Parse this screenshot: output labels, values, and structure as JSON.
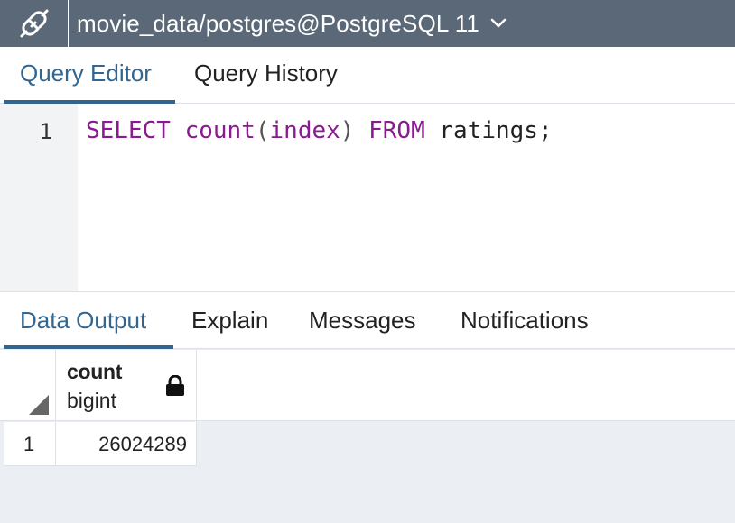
{
  "titlebar": {
    "connection_label": "movie_data/postgres@PostgreSQL 11",
    "connection_icon": "plug-disconnected-icon",
    "dropdown_icon": "chevron-down-icon"
  },
  "editor_tabs": [
    {
      "label": "Query Editor",
      "active": true
    },
    {
      "label": "Query History",
      "active": false
    }
  ],
  "editor": {
    "line_numbers": [
      "1"
    ],
    "tokens": {
      "t1": "SELECT",
      "t2": " ",
      "t3": "count",
      "t4": "(",
      "t5": "index",
      "t6": ")",
      "t7": " ",
      "t8": "FROM",
      "t9": " ratings;"
    }
  },
  "output_tabs": [
    {
      "label": "Data Output",
      "active": true
    },
    {
      "label": "Explain",
      "active": false
    },
    {
      "label": "Messages",
      "active": false
    },
    {
      "label": "Notifications",
      "active": false
    }
  ],
  "grid": {
    "columns": [
      {
        "name": "count",
        "type": "bigint",
        "icon": "lock-icon"
      }
    ],
    "rows": [
      {
        "row_number": "1",
        "cells": [
          "26024289"
        ]
      }
    ]
  },
  "colors": {
    "accent": "#326690",
    "titlebar_bg": "#5b6877",
    "keyword": "#8a1a8f"
  }
}
